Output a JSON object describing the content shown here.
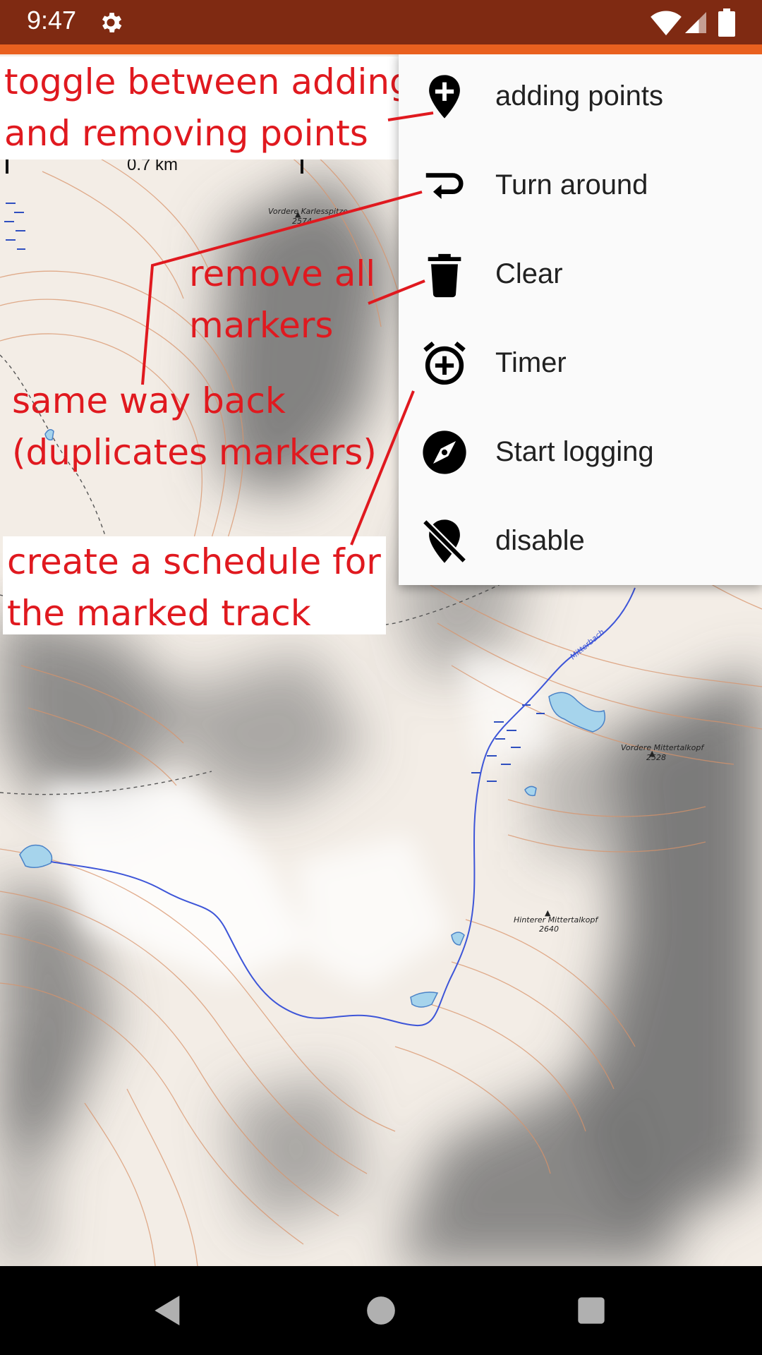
{
  "status_bar": {
    "time": "9:47",
    "icons": [
      "gear-icon",
      "wifi-icon",
      "signal-icon",
      "battery-icon"
    ],
    "background": "#7f2a12"
  },
  "accent_color": "#e9601f",
  "map": {
    "scale_label": "0.7 km",
    "labels": {
      "peak_1_name": "Vordere Karlesspitze",
      "peak_1_elev": "2574",
      "peak_2_name": "Vordere Mittertalkopf",
      "peak_2_elev": "2528",
      "peak_3_name": "Hinterer Mittertalkopf",
      "peak_3_elev": "2640",
      "stream_name": "Mitterbach"
    }
  },
  "menu": {
    "items": [
      {
        "label": "adding points",
        "icon": "add-location-icon"
      },
      {
        "label": "Turn around",
        "icon": "turn-around-icon"
      },
      {
        "label": "Clear",
        "icon": "trash-icon"
      },
      {
        "label": "Timer",
        "icon": "alarm-add-icon"
      },
      {
        "label": "Start logging",
        "icon": "compass-icon"
      },
      {
        "label": "disable",
        "icon": "location-off-icon"
      }
    ]
  },
  "annotations": {
    "toggle": "toggle between adding\nand removing points",
    "remove": "remove all\nmarkers",
    "same_way": "same way back\n(duplicates markers)",
    "schedule": "create a schedule for\nthe marked track",
    "color": "#e0191f"
  },
  "nav_bar": {
    "icons": [
      "back-icon",
      "home-icon",
      "recents-icon"
    ]
  }
}
